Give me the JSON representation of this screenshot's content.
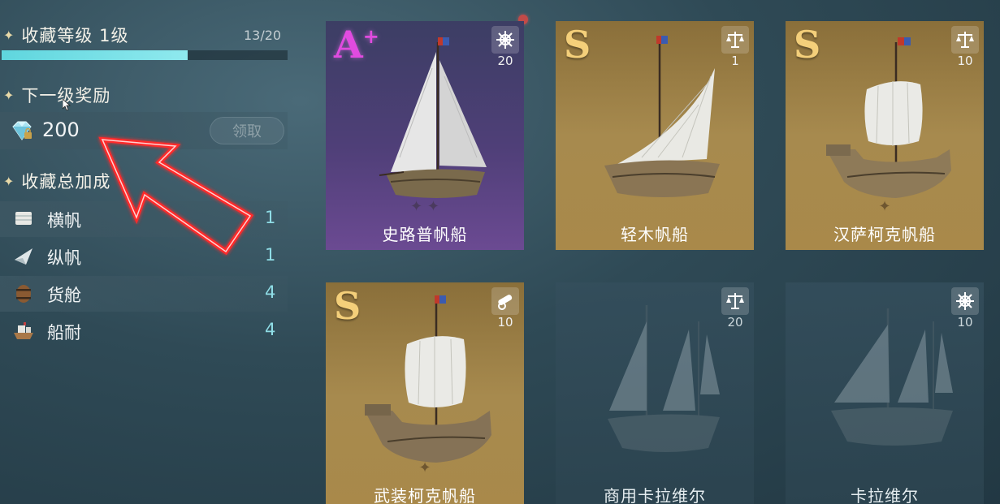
{
  "collection": {
    "level_title": "收藏等级 1级",
    "progress_text": "13/20",
    "progress_fraction": 0.65
  },
  "next_reward": {
    "title": "下一级奖励",
    "amount": "200",
    "claim_label": "领取"
  },
  "bonus": {
    "title": "收藏总加成",
    "items": [
      {
        "label": "横帆",
        "value": "1",
        "icon": "square-sail-icon"
      },
      {
        "label": "纵帆",
        "value": "1",
        "icon": "fore-and-aft-sail-icon"
      },
      {
        "label": "货舱",
        "value": "4",
        "icon": "barrel-icon"
      },
      {
        "label": "船耐",
        "value": "4",
        "icon": "hull-icon"
      }
    ]
  },
  "ships": [
    {
      "name": "史路普帆船",
      "rank": "A",
      "rank_sup": "+",
      "type_icon": "helm-icon",
      "type_count": "20",
      "style": "purple"
    },
    {
      "name": "轻木帆船",
      "rank": "S",
      "type_icon": "scales-icon",
      "type_count": "1",
      "style": "gold"
    },
    {
      "name": "汉萨柯克帆船",
      "rank": "S",
      "type_icon": "scales-icon",
      "type_count": "10",
      "style": "gold"
    },
    {
      "name": "武装柯克帆船",
      "rank": "S",
      "type_icon": "cannon-icon",
      "type_count": "10",
      "style": "gold"
    },
    {
      "name": "商用卡拉维尔",
      "rank": "",
      "type_icon": "scales-icon",
      "type_count": "20",
      "style": "locked"
    },
    {
      "name": "卡拉维尔",
      "rank": "",
      "type_icon": "helm-icon",
      "type_count": "10",
      "style": "locked"
    }
  ],
  "colors": {
    "progress_fill": "#6fdde4",
    "bonus_value": "#8fdde6",
    "rank_s": "#f4cf7a",
    "rank_aplus": "#e14be0",
    "card_gold": "#a78a4e",
    "card_purple": "#4f3f78",
    "arrow_red": "#ff2a2a"
  }
}
